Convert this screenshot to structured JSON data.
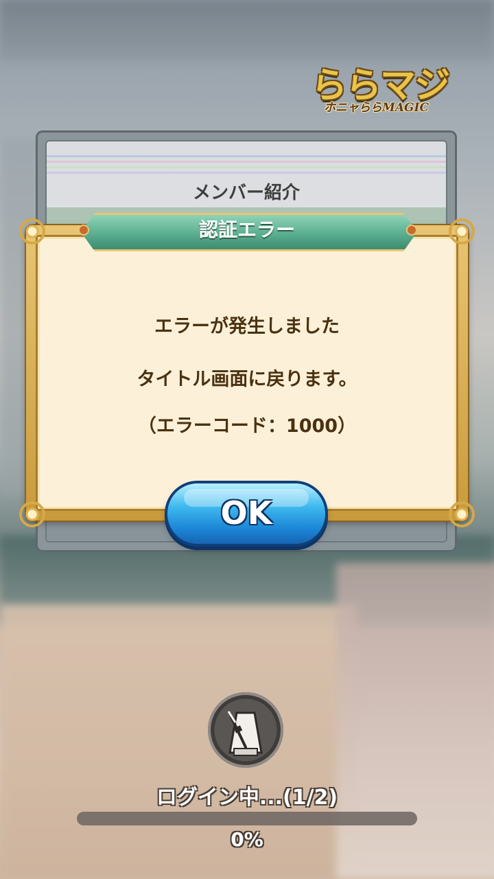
{
  "logo": {
    "main_text": "ららマジ",
    "sub_text": "ホニャららMAGIC"
  },
  "member_card": {
    "title": "メンバー紹介"
  },
  "dialog": {
    "title": "認証エラー",
    "message_line1": "エラーが発生しました",
    "message_line2": "タイトル画面に戻ります。",
    "message_line3": "（エラーコード：1000）",
    "ok_label": "OK"
  },
  "loading": {
    "status_text": "ログイン中...(1/2)",
    "progress_percent_text": "0%",
    "progress_fraction": 0
  },
  "colors": {
    "title_bar_green": "#5fb293",
    "dialog_gold": "#e8c574",
    "panel_cream": "#fcf1d8",
    "ok_button_blue": "#1b86d6",
    "progress_fill": "#f4c455"
  },
  "icons": {
    "loading_icon": "metronome-icon"
  }
}
